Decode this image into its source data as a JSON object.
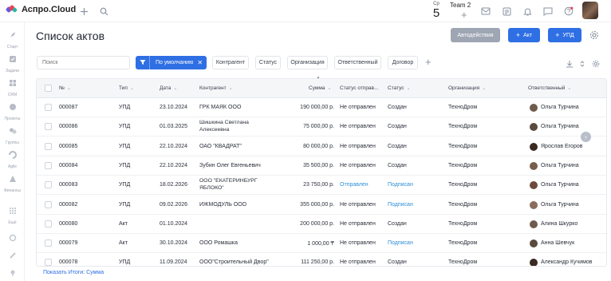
{
  "app": {
    "logo_text": "Аспро.Cloud",
    "date_weekday": "Ср",
    "date_day": "5",
    "team_label": "Team 2"
  },
  "sidebar": {
    "items": [
      {
        "label": "Старт",
        "icon": "rocket-icon"
      },
      {
        "label": "Задачи",
        "icon": "tasks-icon"
      },
      {
        "label": "CRM",
        "icon": "crm-icon"
      },
      {
        "label": "Проекты",
        "icon": "projects-icon"
      },
      {
        "label": "Группы",
        "icon": "groups-icon"
      },
      {
        "label": "Agile",
        "icon": "agile-icon"
      },
      {
        "label": "Финансы",
        "icon": "finance-icon"
      },
      {
        "label": "Ещё",
        "icon": "more-icon"
      }
    ]
  },
  "page": {
    "title": "Список актов",
    "autoactions_label": "Автодействия",
    "add_act_label": "Акт",
    "add_upd_label": "УПД"
  },
  "filters": {
    "search_placeholder": "Поиск",
    "default_filter_label": "По умолчанию",
    "chips": [
      "Контрагент",
      "Статус",
      "Организация",
      "Ответственный",
      "Договор"
    ]
  },
  "table": {
    "columns": [
      "№",
      "Тип",
      "Дата",
      "Контрагент",
      "Сумма",
      "Статус отправ...",
      "Статус",
      "Организация",
      "Ответственный"
    ],
    "rows": [
      {
        "num": "000087",
        "type": "УПД",
        "date": "23.10.2024",
        "counterparty": "ГРК МАЯК ООО",
        "counterparty2": "",
        "sum": "190 000,00 р.",
        "send_status": "Не отправлен",
        "status": "Создан",
        "org": "ТехноДром",
        "responsible": "Ольга Турчина",
        "send_blue": false,
        "status_blue": false
      },
      {
        "num": "000086",
        "type": "УПД",
        "date": "01.03.2025",
        "counterparty": "Шишкина Светлана",
        "counterparty2": "Алексеевна",
        "sum": "75 000,00 р.",
        "send_status": "Не отправлен",
        "status": "Создан",
        "org": "ТехноДром",
        "responsible": "Ольга Турчина",
        "send_blue": false,
        "status_blue": false
      },
      {
        "num": "000085",
        "type": "УПД",
        "date": "22.10.2024",
        "counterparty": "ОАО \"КВАДРАТ\"",
        "counterparty2": "",
        "sum": "80 000,00 р.",
        "send_status": "Не отправлен",
        "status": "Создан",
        "org": "ТехноДром",
        "responsible": "Ярослав Егоров",
        "send_blue": false,
        "status_blue": false
      },
      {
        "num": "000084",
        "type": "УПД",
        "date": "22.10.2024",
        "counterparty": "Зубин Олег Евгеньевич",
        "counterparty2": "",
        "sum": "35 500,00 р.",
        "send_status": "Не отправлен",
        "status": "Создан",
        "org": "ТехноДром",
        "responsible": "Ольга Турчина",
        "send_blue": false,
        "status_blue": false
      },
      {
        "num": "000083",
        "type": "УПД",
        "date": "18.02.2026",
        "counterparty": "ООО \"ЕКАТЕРИНБУРГ",
        "counterparty2": "ЯБЛОКО\"",
        "sum": "23 750,00 р.",
        "send_status": "Отправлен",
        "status": "Подписан",
        "org": "ТехноДром",
        "responsible": "Ольга Турчина",
        "send_blue": true,
        "status_blue": true
      },
      {
        "num": "000082",
        "type": "УПД",
        "date": "09.02.2026",
        "counterparty": "ИЖМОДУЛЬ ООО",
        "counterparty2": "",
        "sum": "355 000,00 р.",
        "send_status": "Не отправлен",
        "status": "Подписан",
        "org": "ТехноДром",
        "responsible": "Ольга Турчина",
        "send_blue": false,
        "status_blue": true
      },
      {
        "num": "000080",
        "type": "Акт",
        "date": "01.10.2024",
        "counterparty": "",
        "counterparty2": "",
        "sum": "200 000,00 р.",
        "send_status": "Не отправлен",
        "status": "Создан",
        "org": "ТехноДром",
        "responsible": "Алина Шкурко",
        "send_blue": false,
        "status_blue": false
      },
      {
        "num": "000079",
        "type": "Акт",
        "date": "30.10.2024",
        "counterparty": "ООО Ромашка",
        "counterparty2": "",
        "sum": "1 000,00 ₸",
        "send_status": "Не отправлен",
        "status": "Подписан",
        "org": "ТехноДром",
        "responsible": "Анна Шевчук",
        "send_blue": false,
        "status_blue": true
      },
      {
        "num": "000078",
        "type": "УПД",
        "date": "11.09.2024",
        "counterparty": "ООО\"Строительный Двор\"",
        "counterparty2": "",
        "sum": "111 250,00 р.",
        "send_status": "Не отправлен",
        "status": "Создан",
        "org": "ТехноДром",
        "responsible": "Александр Кучимов",
        "send_blue": false,
        "status_blue": false
      }
    ]
  },
  "footer": {
    "totals_link": "Показать Итоги: Сумма"
  },
  "colors": {
    "accent": "#2f6fe4",
    "link_status": "#2f8fd8",
    "gray_button": "#9ea6b3"
  }
}
